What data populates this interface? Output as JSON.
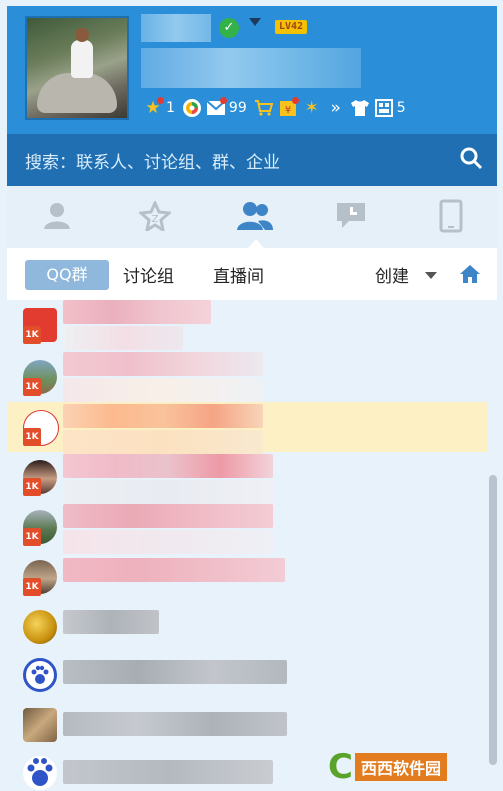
{
  "header": {
    "level": "LV42",
    "toolbar": [
      {
        "icon": "star-icon",
        "count": "1"
      },
      {
        "icon": "qzone-icon",
        "count": ""
      },
      {
        "icon": "mail-icon",
        "count": "99"
      },
      {
        "icon": "cart-icon",
        "count": ""
      },
      {
        "icon": "wallet-icon",
        "count": ""
      },
      {
        "icon": "dance-icon",
        "count": ""
      },
      {
        "icon": "more-icon",
        "label": "»"
      },
      {
        "icon": "shirt-icon",
        "count": ""
      },
      {
        "icon": "apps-icon",
        "count": "5"
      }
    ]
  },
  "search": {
    "placeholder": "搜索：联系人、讨论组、群、企业"
  },
  "main_tabs": [
    "contacts-tab",
    "favorites-tab",
    "groups-tab",
    "messages-tab",
    "phone-tab"
  ],
  "sub_tabs": {
    "qq_group": "QQ群",
    "discussion": "讨论组",
    "live": "直播间",
    "create": "创建"
  },
  "groups": [
    {
      "badge": "1K",
      "has_dot": true,
      "selected": false
    },
    {
      "badge": "1K",
      "has_dot": false,
      "selected": false
    },
    {
      "badge": "1K",
      "has_dot": false,
      "selected": true
    },
    {
      "badge": "1K",
      "has_dot": false,
      "selected": false
    },
    {
      "badge": "1K",
      "has_dot": false,
      "selected": false
    },
    {
      "badge": "1K",
      "has_dot": false,
      "selected": false
    },
    {
      "badge": "",
      "has_dot": false,
      "selected": false
    },
    {
      "badge": "",
      "has_dot": false,
      "selected": false
    },
    {
      "badge": "",
      "has_dot": false,
      "selected": false
    },
    {
      "badge": "",
      "has_dot": false,
      "selected": false
    }
  ],
  "watermark": {
    "text": "西西软件园"
  }
}
